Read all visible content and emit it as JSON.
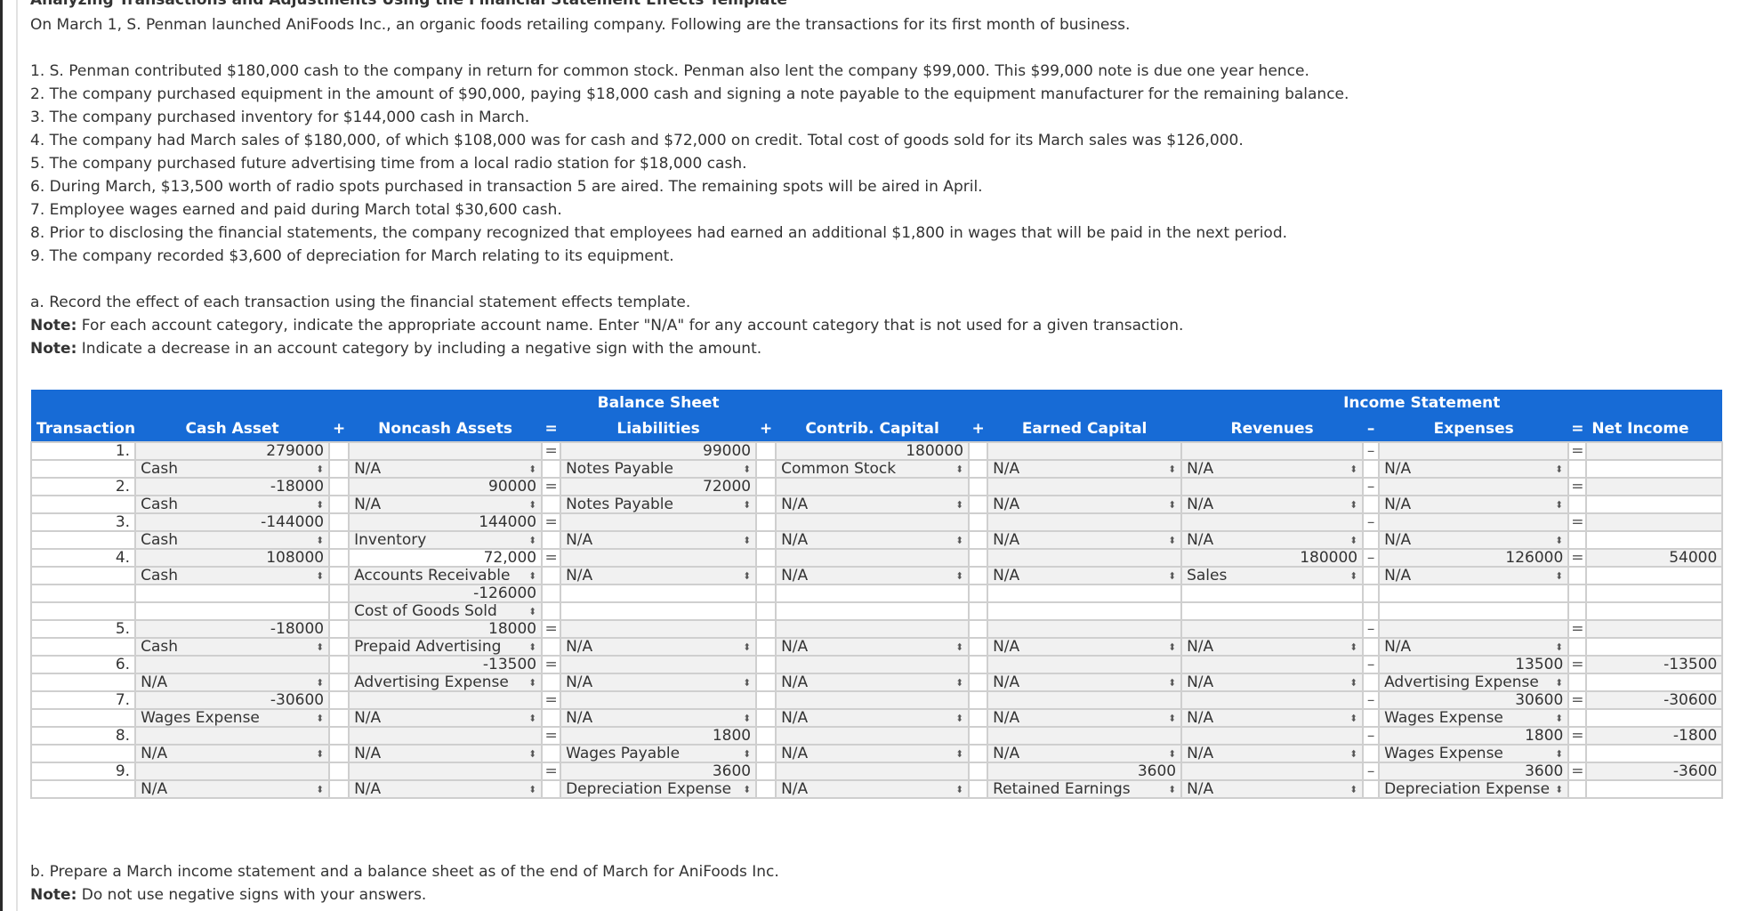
{
  "title": "Analyzing Transactions and Adjustments Using the Financial Statement Effects Template",
  "intro": "On March 1, S. Penman launched AniFoods Inc., an organic foods retailing company. Following are the transactions for its first month of business.",
  "transactions_text": [
    "1. S. Penman contributed $180,000 cash to the company in return for common stock. Penman also lent the company $99,000. This $99,000 note is due one year hence.",
    "2. The company purchased equipment in the amount of $90,000, paying $18,000 cash and signing a note payable to the equipment manufacturer for the remaining balance.",
    "3. The company purchased inventory for $144,000 cash in March.",
    "4. The company had March sales of $180,000, of which $108,000 was for cash and $72,000 on credit. Total cost of goods sold for its March sales was $126,000.",
    "5. The company purchased future advertising time from a local radio station for $18,000 cash.",
    "6. During March, $13,500 worth of radio spots purchased in transaction 5 are aired. The remaining spots will be aired in April.",
    "7. Employee wages earned and paid during March total $30,600 cash.",
    "8. Prior to disclosing the financial statements, the company recognized that employees had earned an additional $1,800 in wages that will be paid in the next period.",
    "9. The company recorded $3,600 of depreciation for March relating to its equipment."
  ],
  "part_a": {
    "instruction": "a. Record the effect of each transaction using the financial statement effects template.",
    "note_label": "Note:",
    "note1": " For each account category, indicate the appropriate account name. Enter \"N/A\" for any account category that is not used for a given transaction.",
    "note2": " Indicate a decrease in an account category by including a negative sign with the amount."
  },
  "table": {
    "group_headers": {
      "balance_sheet": "Balance Sheet",
      "income_statement": "Income Statement"
    },
    "headers": {
      "transaction": "Transaction",
      "cash": "Cash Asset",
      "plus1": "+",
      "noncash": "Noncash Assets",
      "eq1": "=",
      "liabilities": "Liabilities",
      "plus2": "+",
      "contrib": "Contrib. Capital",
      "plus3": "+",
      "earned": "Earned Capital",
      "revenues": "Revenues",
      "minus": "–",
      "expenses": "Expenses",
      "eq2": "=",
      "net_income": "Net Income"
    },
    "op_eq": "=",
    "op_minus": "–",
    "rows": [
      {
        "n": "1.",
        "cash": "279000",
        "noncash": "",
        "liab": "99000",
        "contrib": "180000",
        "earned": "",
        "rev": "",
        "exp": "",
        "ni": "",
        "cash_acct": "Cash",
        "noncash_acct": "N/A",
        "liab_acct": "Notes Payable",
        "contrib_acct": "Common Stock",
        "earned_acct": "N/A",
        "rev_acct": "N/A",
        "exp_acct": "N/A"
      },
      {
        "n": "2.",
        "cash": "-18000",
        "noncash": "90000",
        "liab": "72000",
        "contrib": "",
        "earned": "",
        "rev": "",
        "exp": "",
        "ni": "",
        "cash_acct": "Cash",
        "noncash_acct": "N/A",
        "liab_acct": "Notes Payable",
        "contrib_acct": "N/A",
        "earned_acct": "N/A",
        "rev_acct": "N/A",
        "exp_acct": "N/A"
      },
      {
        "n": "3.",
        "cash": "-144000",
        "noncash": "144000",
        "liab": "",
        "contrib": "",
        "earned": "",
        "rev": "",
        "exp": "",
        "ni": "",
        "cash_acct": "Cash",
        "noncash_acct": "Inventory",
        "liab_acct": "N/A",
        "contrib_acct": "N/A",
        "earned_acct": "N/A",
        "rev_acct": "N/A",
        "exp_acct": "N/A"
      },
      {
        "n": "4.",
        "cash": "108000",
        "noncash": "72,000",
        "liab": "",
        "contrib": "",
        "earned": "",
        "rev": "180000",
        "exp": "126000",
        "ni": "54000",
        "cash_acct": "Cash",
        "noncash_acct": "Accounts Receivable",
        "liab_acct": "N/A",
        "contrib_acct": "N/A",
        "earned_acct": "N/A",
        "rev_acct": "Sales",
        "exp_acct": "N/A",
        "extra_noncash": "-126000",
        "extra_noncash_acct": "Cost of Goods Sold"
      },
      {
        "n": "5.",
        "cash": "-18000",
        "noncash": "18000",
        "liab": "",
        "contrib": "",
        "earned": "",
        "rev": "",
        "exp": "",
        "ni": "",
        "cash_acct": "Cash",
        "noncash_acct": "Prepaid Advertising",
        "liab_acct": "N/A",
        "contrib_acct": "N/A",
        "earned_acct": "N/A",
        "rev_acct": "N/A",
        "exp_acct": "N/A"
      },
      {
        "n": "6.",
        "cash": "",
        "noncash": "-13500",
        "liab": "",
        "contrib": "",
        "earned": "",
        "rev": "",
        "exp": "13500",
        "ni": "-13500",
        "cash_acct": "N/A",
        "noncash_acct": "Advertising Expense",
        "liab_acct": "N/A",
        "contrib_acct": "N/A",
        "earned_acct": "N/A",
        "rev_acct": "N/A",
        "exp_acct": "Advertising Expense"
      },
      {
        "n": "7.",
        "cash": "-30600",
        "noncash": "",
        "liab": "",
        "contrib": "",
        "earned": "",
        "rev": "",
        "exp": "30600",
        "ni": "-30600",
        "cash_acct": "Wages Expense",
        "noncash_acct": "N/A",
        "liab_acct": "N/A",
        "contrib_acct": "N/A",
        "earned_acct": "N/A",
        "rev_acct": "N/A",
        "exp_acct": "Wages Expense"
      },
      {
        "n": "8.",
        "cash": "",
        "noncash": "",
        "liab": "1800",
        "contrib": "",
        "earned": "",
        "rev": "",
        "exp": "1800",
        "ni": "-1800",
        "cash_acct": "N/A",
        "noncash_acct": "N/A",
        "liab_acct": "Wages Payable",
        "contrib_acct": "N/A",
        "earned_acct": "N/A",
        "rev_acct": "N/A",
        "exp_acct": "Wages Expense"
      },
      {
        "n": "9.",
        "cash": "",
        "noncash": "",
        "liab": "3600",
        "contrib": "",
        "earned": "3600",
        "rev": "",
        "exp": "3600",
        "ni": "-3600",
        "cash_acct": "N/A",
        "noncash_acct": "N/A",
        "liab_acct": "Depreciation Expense",
        "contrib_acct": "N/A",
        "earned_acct": "Retained Earnings",
        "rev_acct": "N/A",
        "exp_acct": "Depreciation Expense"
      }
    ]
  },
  "part_b": {
    "instruction": "b. Prepare a March income statement and a balance sheet as of the end of March for AniFoods Inc.",
    "note_label": "Note:",
    "note": " Do not use negative signs with your answers."
  },
  "icons": {
    "select_arrows": "↕"
  }
}
